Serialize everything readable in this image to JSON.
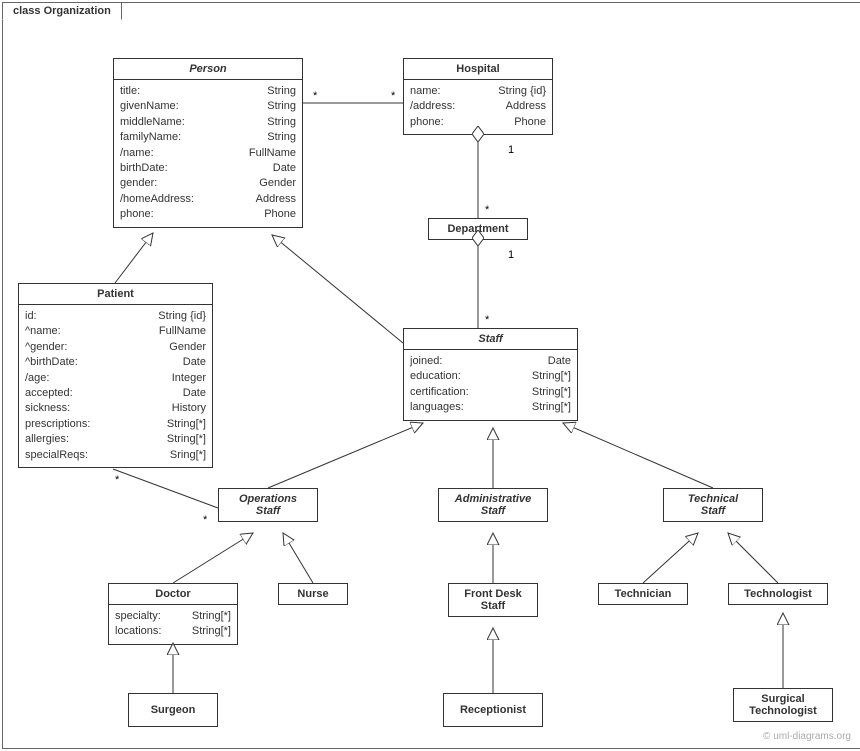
{
  "frame": {
    "title": "class Organization"
  },
  "watermark": "© uml-diagrams.org",
  "classes": {
    "person": {
      "name": "Person",
      "attrs": [
        {
          "n": "title:",
          "t": "String"
        },
        {
          "n": "givenName:",
          "t": "String"
        },
        {
          "n": "middleName:",
          "t": "String"
        },
        {
          "n": "familyName:",
          "t": "String"
        },
        {
          "n": "/name:",
          "t": "FullName"
        },
        {
          "n": "birthDate:",
          "t": "Date"
        },
        {
          "n": "gender:",
          "t": "Gender"
        },
        {
          "n": "/homeAddress:",
          "t": "Address"
        },
        {
          "n": "phone:",
          "t": "Phone"
        }
      ]
    },
    "hospital": {
      "name": "Hospital",
      "attrs": [
        {
          "n": "name:",
          "t": "String {id}"
        },
        {
          "n": "/address:",
          "t": "Address"
        },
        {
          "n": "phone:",
          "t": "Phone"
        }
      ]
    },
    "department": {
      "name": "Department"
    },
    "patient": {
      "name": "Patient",
      "attrs": [
        {
          "n": "id:",
          "t": "String {id}"
        },
        {
          "n": "^name:",
          "t": "FullName"
        },
        {
          "n": "^gender:",
          "t": "Gender"
        },
        {
          "n": "^birthDate:",
          "t": "Date"
        },
        {
          "n": "/age:",
          "t": "Integer"
        },
        {
          "n": "accepted:",
          "t": "Date"
        },
        {
          "n": "sickness:",
          "t": "History"
        },
        {
          "n": "prescriptions:",
          "t": "String[*]"
        },
        {
          "n": "allergies:",
          "t": "String[*]"
        },
        {
          "n": "specialReqs:",
          "t": "Sring[*]"
        }
      ]
    },
    "staff": {
      "name": "Staff",
      "attrs": [
        {
          "n": "joined:",
          "t": "Date"
        },
        {
          "n": "education:",
          "t": "String[*]"
        },
        {
          "n": "certification:",
          "t": "String[*]"
        },
        {
          "n": "languages:",
          "t": "String[*]"
        }
      ]
    },
    "operationsStaff": {
      "name": "Operations",
      "line2": "Staff"
    },
    "administrativeStaff": {
      "name": "Administrative",
      "line2": "Staff"
    },
    "technicalStaff": {
      "name": "Technical",
      "line2": "Staff"
    },
    "doctor": {
      "name": "Doctor",
      "attrs": [
        {
          "n": "specialty:",
          "t": "String[*]"
        },
        {
          "n": "locations:",
          "t": "String[*]"
        }
      ]
    },
    "nurse": {
      "name": "Nurse"
    },
    "frontDeskStaff": {
      "name": "Front Desk",
      "line2": "Staff"
    },
    "technician": {
      "name": "Technician"
    },
    "technologist": {
      "name": "Technologist"
    },
    "surgeon": {
      "name": "Surgeon"
    },
    "receptionist": {
      "name": "Receptionist"
    },
    "surgicalTechnologist": {
      "name": "Surgical",
      "line2": "Technologist"
    }
  },
  "multiplicities": {
    "person_hospital_left": "*",
    "person_hospital_right": "*",
    "hospital_dept_top": "1",
    "hospital_dept_bottom": "*",
    "dept_staff_top": "1",
    "dept_staff_bottom": "*",
    "patient_ops_left": "*",
    "patient_ops_right": "*"
  }
}
